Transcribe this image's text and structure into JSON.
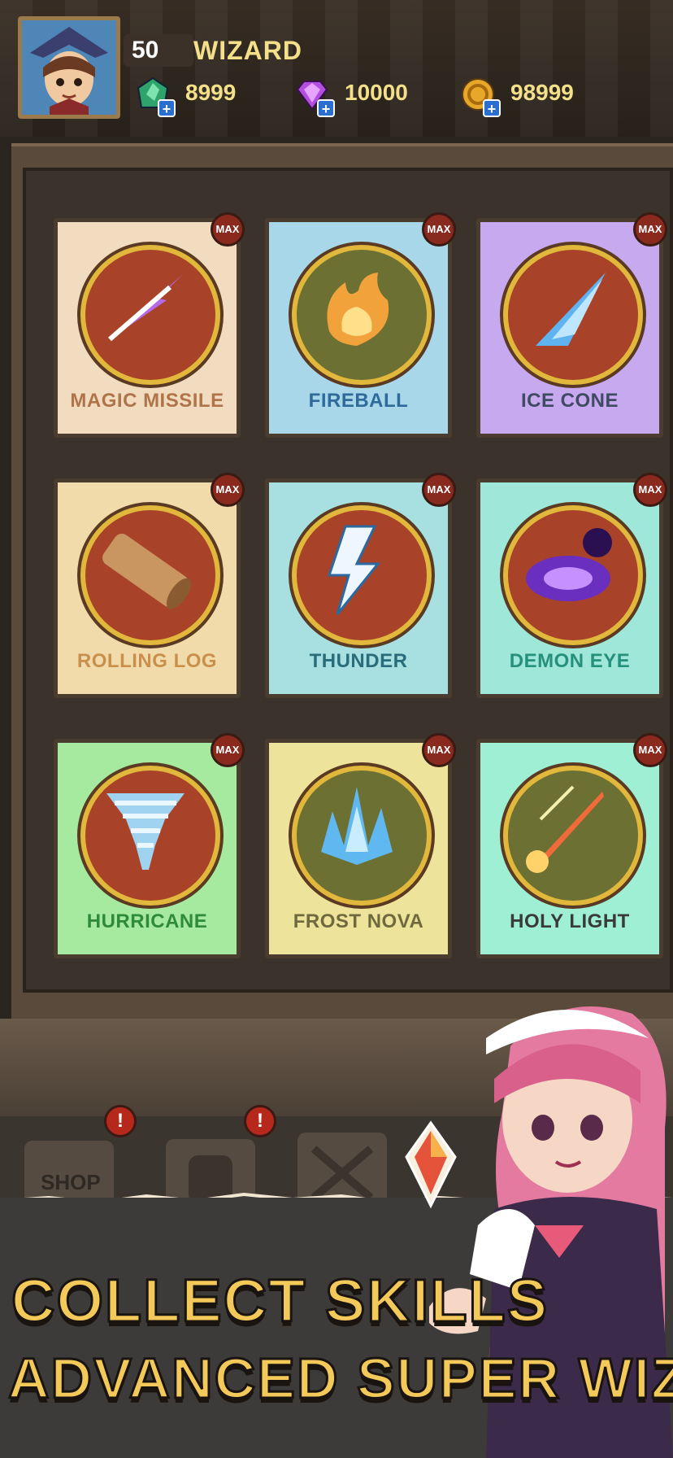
{
  "player": {
    "level": "50",
    "name": "WIZARD"
  },
  "currencies": [
    {
      "name": "emerald",
      "icon": "emerald-icon",
      "value": "8999"
    },
    {
      "name": "diamond",
      "icon": "diamond-icon",
      "value": "10000"
    },
    {
      "name": "gold",
      "icon": "coin-icon",
      "value": "98999"
    }
  ],
  "skills": [
    {
      "name": "MAGIC MISSILE",
      "badge": "MAX"
    },
    {
      "name": "FIREBALL",
      "badge": "MAX"
    },
    {
      "name": "ICE CONE",
      "badge": "MAX"
    },
    {
      "name": "ROLLING LOG",
      "badge": "MAX"
    },
    {
      "name": "THUNDER",
      "badge": "MAX"
    },
    {
      "name": "DEMON EYE",
      "badge": "MAX"
    },
    {
      "name": "HURRICANE",
      "badge": "MAX"
    },
    {
      "name": "FROST NOVA",
      "badge": "MAX"
    },
    {
      "name": "HOLY LIGHT",
      "badge": "MAX"
    }
  ],
  "nav": {
    "shop_label": "SHOP",
    "alert_mark": "!"
  },
  "promo": {
    "line1": "COLLECT SKILLS",
    "line2": "ADVANCED SUPER WIZARD"
  },
  "colors": {
    "card_bg": [
      "#f2dcc0",
      "#a9d7ea",
      "#c7a9ef",
      "#f2dbab",
      "#a8dfe0",
      "#9fe7d8",
      "#a6ea9f",
      "#eee39a",
      "#9fefd4"
    ],
    "label": [
      "#b0744a",
      "#2f6a9a",
      "#3f4a63",
      "#c9904d",
      "#2a6d7a",
      "#26907c",
      "#2f8a3b",
      "#6f6a3e",
      "#3a3a3a"
    ],
    "text_gold": "#f4e08a"
  }
}
